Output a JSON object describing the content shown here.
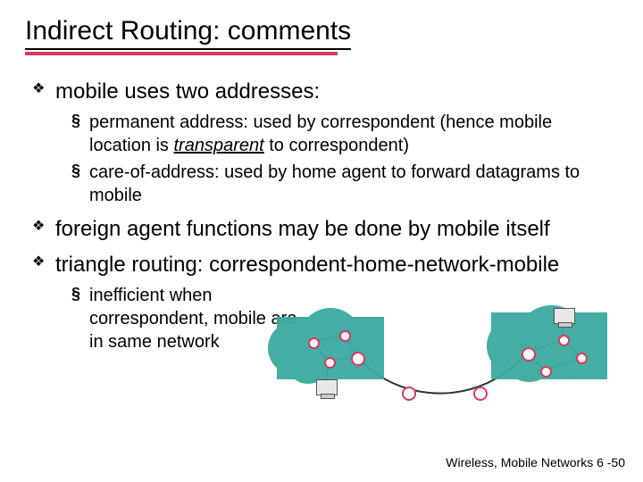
{
  "title": "Indirect Routing: comments",
  "bullets": {
    "b1": "mobile uses two addresses:",
    "b1_sub1_a": "permanent address: used by correspondent (hence mobile location is ",
    "b1_sub1_em": "transparent",
    "b1_sub1_b": " to correspondent)",
    "b1_sub2": "care-of-address: used by home agent to forward datagrams to mobile",
    "b2": "foreign agent functions may be done by mobile itself",
    "b3": "triangle routing: correspondent-home-network-mobile",
    "b3_sub1": "inefficient when correspondent, mobile are in same network"
  },
  "footer": "Wireless, Mobile Networks  6 -50"
}
